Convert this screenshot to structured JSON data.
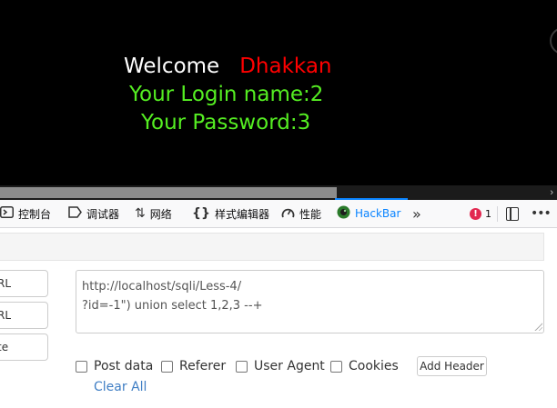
{
  "page": {
    "welcome_word": "Welcome",
    "user_name": "Dhakkan",
    "login_line": "Your Login name:2",
    "password_line": "Your Password:3"
  },
  "devtools": {
    "tabs": [
      {
        "label": "控制台",
        "icon": "console-icon"
      },
      {
        "label": "调试器",
        "icon": "debugger-icon"
      },
      {
        "label": "网络",
        "icon": "network-icon"
      },
      {
        "label": "样式编辑器",
        "icon": "style-editor-icon"
      },
      {
        "label": "性能",
        "icon": "performance-icon"
      },
      {
        "label": "HackBar",
        "icon": "hackbar-icon",
        "active": true
      }
    ],
    "error_count": "1",
    "active_color": "#0a84ff"
  },
  "hackbar": {
    "buttons": {
      "load_url": "RL",
      "split_url": "RL",
      "execute": "te"
    },
    "url_value": "http://localhost/sqli/Less-4/\n?id=-1\") union select 1,2,3 --+",
    "options": {
      "post_data": "Post data",
      "referer": "Referer",
      "user_agent": "User Agent",
      "cookies": "Cookies"
    },
    "add_header": "Add Header",
    "clear_all": "Clear All"
  },
  "colors": {
    "welcome": "#ffffff",
    "user_name": "#ff0000",
    "credentials": "#55ee22",
    "link": "#3f7ec4"
  }
}
